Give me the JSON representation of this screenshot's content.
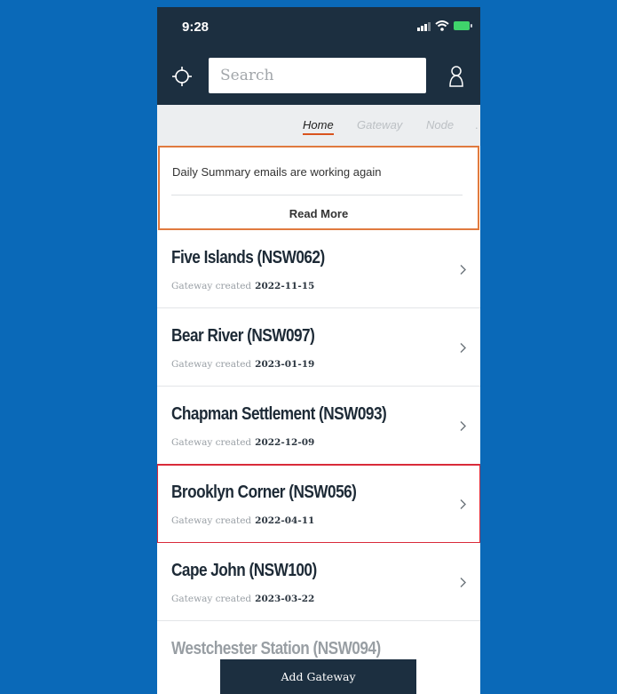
{
  "status_bar": {
    "time": "9:28"
  },
  "header": {
    "locate_icon": "crosshair-icon",
    "search_placeholder": "Search",
    "user_icon": "user-icon"
  },
  "tabs": [
    {
      "label": "Home",
      "active": true
    },
    {
      "label": "Gateway",
      "active": false
    },
    {
      "label": "Node",
      "active": false
    }
  ],
  "notice": {
    "text": "Daily Summary emails are working again",
    "action_label": "Read More",
    "border_color": "#e07a3f"
  },
  "gateways": [
    {
      "name": "Five Islands (NSW062)",
      "meta_label": "Gateway created",
      "date": "2022-11-15",
      "highlighted": false
    },
    {
      "name": "Bear River (NSW097)",
      "meta_label": "Gateway created",
      "date": "2023-01-19",
      "highlighted": false
    },
    {
      "name": "Chapman Settlement (NSW093)",
      "meta_label": "Gateway created",
      "date": "2022-12-09",
      "highlighted": false
    },
    {
      "name": "Brooklyn Corner (NSW056)",
      "meta_label": "Gateway created",
      "date": "2022-04-11",
      "highlighted": true
    },
    {
      "name": "Cape John (NSW100)",
      "meta_label": "Gateway created",
      "date": "2023-03-22",
      "highlighted": false
    },
    {
      "name": "Westchester Station (NSW094)",
      "meta_label": "",
      "date": "",
      "highlighted": false
    }
  ],
  "add_gateway_label": "Add Gateway",
  "colors": {
    "page_background": "#0a69b8",
    "header_background": "#1c2f40",
    "accent": "#d9541e",
    "highlight": "#d92b3a"
  }
}
